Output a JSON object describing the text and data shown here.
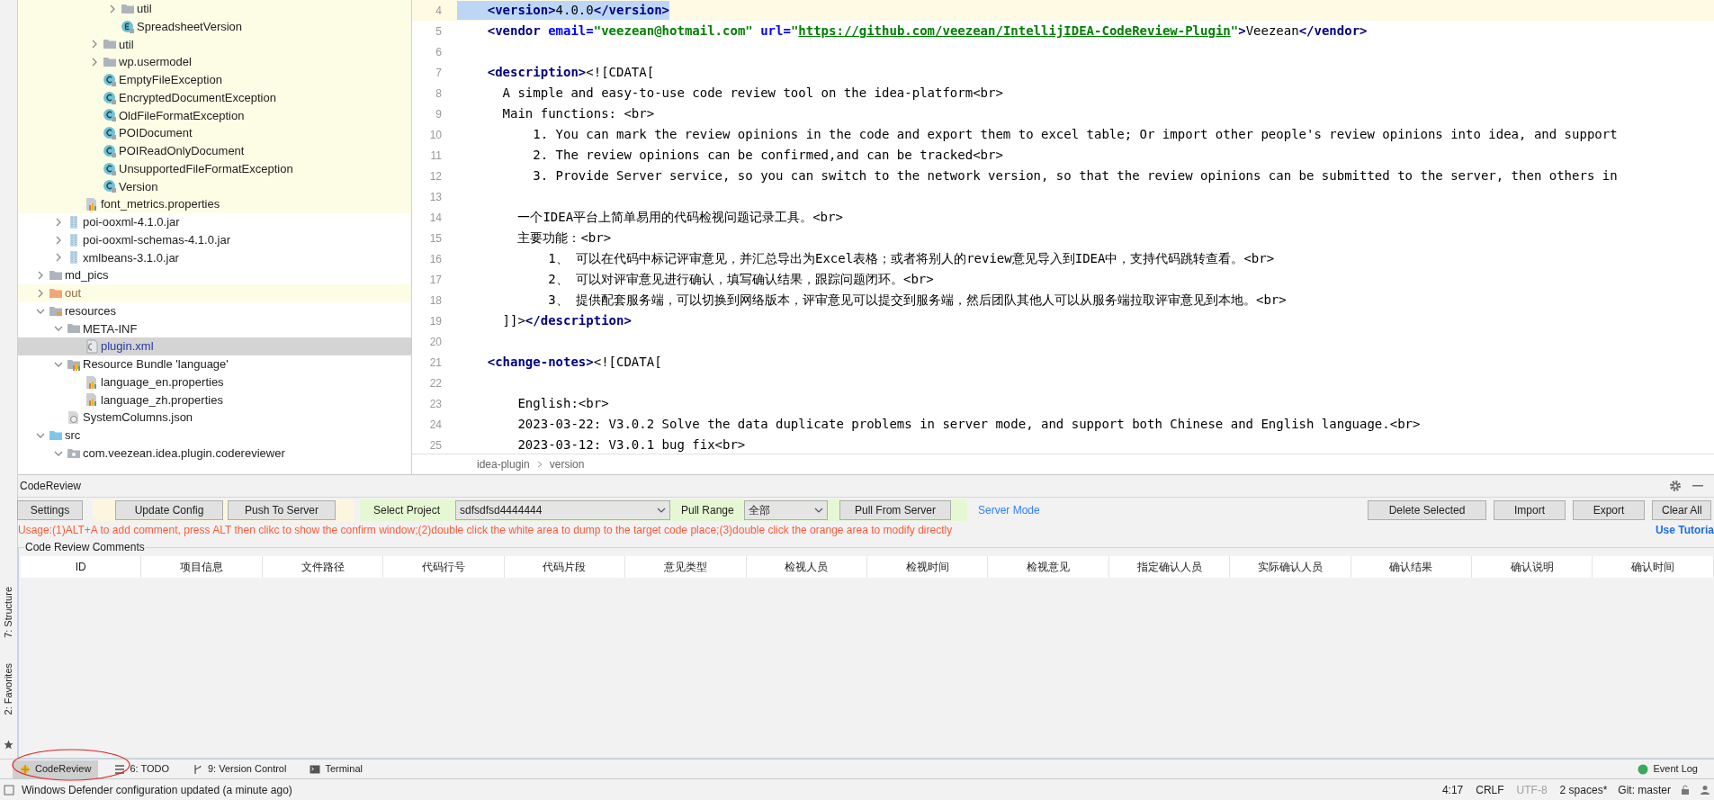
{
  "tool_stripe": [
    {
      "label": "7: Structure"
    },
    {
      "label": "2: Favorites"
    }
  ],
  "project_tree": [
    {
      "children": [
        {
          "children": [
            {
              "children": [
                {
                  "children": [
                    {
                      "label": "util",
                      "kind": "folder",
                      "expanded": false,
                      "highlighted": true
                    },
                    {
                      "label": "SpreadsheetVersion",
                      "kind": "enum",
                      "highlighted": true
                    }
                  ]
                },
                {
                  "label": "util",
                  "kind": "folder",
                  "expanded": false,
                  "highlighted": true
                },
                {
                  "label": "wp.usermodel",
                  "kind": "folder",
                  "expanded": false,
                  "highlighted": true
                },
                {
                  "label": "EmptyFileException",
                  "kind": "class",
                  "highlighted": true
                },
                {
                  "label": "EncryptedDocumentException",
                  "kind": "class",
                  "highlighted": true
                },
                {
                  "label": "OldFileFormatException",
                  "kind": "class",
                  "highlighted": true
                },
                {
                  "label": "POIDocument",
                  "kind": "class",
                  "highlighted": true
                },
                {
                  "label": "POIReadOnlyDocument",
                  "kind": "class",
                  "highlighted": true
                },
                {
                  "label": "UnsupportedFileFormatException",
                  "kind": "class",
                  "highlighted": true
                },
                {
                  "label": "Version",
                  "kind": "class",
                  "highlighted": true
                }
              ]
            },
            {
              "label": "font_metrics.properties",
              "kind": "properties",
              "highlighted": true
            }
          ]
        },
        {
          "label": "poi-ooxml-4.1.0.jar",
          "kind": "jar",
          "expanded": false,
          "highlighted": false
        },
        {
          "label": "poi-ooxml-schemas-4.1.0.jar",
          "kind": "jar",
          "expanded": false,
          "highlighted": false
        },
        {
          "label": "xmlbeans-3.1.0.jar",
          "kind": "jar",
          "expanded": false,
          "highlighted": false
        }
      ]
    },
    {
      "label": "md_pics",
      "kind": "folder",
      "expanded": false,
      "highlighted": false
    },
    {
      "label": "out",
      "kind": "excluded-folder",
      "expanded": false,
      "highlighted": true
    },
    {
      "label": "resources",
      "kind": "resource-folder",
      "expanded": true,
      "highlighted": false,
      "children": [
        {
          "label": "META-INF",
          "kind": "folder",
          "expanded": true,
          "highlighted": false,
          "children": [
            {
              "label": "plugin.xml",
              "kind": "xml",
              "selected": true
            }
          ]
        },
        {
          "label": "Resource Bundle 'language'",
          "kind": "bundle",
          "expanded": true,
          "highlighted": false,
          "children": [
            {
              "label": "language_en.properties",
              "kind": "properties",
              "highlighted": false
            },
            {
              "label": "language_zh.properties",
              "kind": "properties",
              "highlighted": false
            }
          ]
        },
        {
          "label": "SystemColumns.json",
          "kind": "json",
          "highlighted": false
        }
      ]
    },
    {
      "label": "src",
      "kind": "source-folder",
      "expanded": true,
      "highlighted": false,
      "children": [
        {
          "label": "com.veezean.idea.plugin.codereviewer",
          "kind": "package",
          "expanded": true,
          "highlighted": false
        }
      ]
    }
  ],
  "editor": {
    "lines": [
      {
        "number": "4",
        "selected": true,
        "segments": [
          {
            "kind": "tag",
            "text": "    <version>"
          },
          {
            "kind": "plain",
            "text": "4.0.0"
          },
          {
            "kind": "tag",
            "text": "</version>"
          }
        ]
      },
      {
        "number": "5",
        "selected": false,
        "segments": [
          {
            "kind": "tag",
            "text": "    <vendor "
          },
          {
            "kind": "attr",
            "text": "email="
          },
          {
            "kind": "string",
            "text": "\"veezean@hotmail.com\" "
          },
          {
            "kind": "attr",
            "text": "url="
          },
          {
            "kind": "string",
            "text": "\""
          },
          {
            "kind": "link",
            "text": "https://github.com/veezean/IntellijIDEA-CodeReview-Plugin"
          },
          {
            "kind": "string",
            "text": "\""
          },
          {
            "kind": "tag",
            "text": ">"
          },
          {
            "kind": "plain",
            "text": "Veezean"
          },
          {
            "kind": "tag",
            "text": "</vendor>"
          }
        ]
      },
      {
        "number": "6",
        "selected": false
      },
      {
        "number": "7",
        "selected": false,
        "segments": [
          {
            "kind": "tag",
            "text": "    <description>"
          },
          {
            "kind": "plain",
            "text": "<![CDATA["
          }
        ]
      },
      {
        "number": "8",
        "selected": false,
        "segments": [
          {
            "kind": "plain",
            "text": "      A simple and easy-to-use code review tool on the idea-platform<br>"
          }
        ]
      },
      {
        "number": "9",
        "selected": false,
        "segments": [
          {
            "kind": "plain",
            "text": "      Main functions: <br>"
          }
        ]
      },
      {
        "number": "10",
        "selected": false,
        "segments": [
          {
            "kind": "plain",
            "text": "          1. You can mark the review opinions in the code and export them to excel table; Or import other people's review opinions into idea, and support"
          }
        ]
      },
      {
        "number": "11",
        "selected": false,
        "segments": [
          {
            "kind": "plain",
            "text": "          2. The review opinions can be confirmed,and can be tracked<br>"
          }
        ]
      },
      {
        "number": "12",
        "selected": false,
        "segments": [
          {
            "kind": "plain",
            "text": "          3. Provide Server service, so you can switch to the network version, so that the review opinions can be submitted to the server, then others in"
          }
        ]
      },
      {
        "number": "13",
        "selected": false
      },
      {
        "number": "14",
        "selected": false,
        "segments": [
          {
            "kind": "plain",
            "text": "        一个IDEA平台上简单易用的代码检视问题记录工具。<br>"
          }
        ]
      },
      {
        "number": "15",
        "selected": false,
        "segments": [
          {
            "kind": "plain",
            "text": "        主要功能：<br>"
          }
        ]
      },
      {
        "number": "16",
        "selected": false,
        "segments": [
          {
            "kind": "plain",
            "text": "            1、 可以在代码中标记评审意见，并汇总导出为Excel表格；或者将别人的review意见导入到IDEA中，支持代码跳转查看。<br>"
          }
        ]
      },
      {
        "number": "17",
        "selected": false,
        "segments": [
          {
            "kind": "plain",
            "text": "            2、 可以对评审意见进行确认，填写确认结果，跟踪问题闭环。<br>"
          }
        ]
      },
      {
        "number": "18",
        "selected": false,
        "segments": [
          {
            "kind": "plain",
            "text": "            3、 提供配套服务端，可以切换到网络版本，评审意见可以提交到服务端，然后团队其他人可以从服务端拉取评审意见到本地。<br>"
          }
        ]
      },
      {
        "number": "19",
        "selected": false,
        "segments": [
          {
            "kind": "plain",
            "text": "      ]]>"
          },
          {
            "kind": "tag",
            "text": "</description>"
          }
        ]
      },
      {
        "number": "20",
        "selected": false
      },
      {
        "number": "21",
        "selected": false,
        "segments": [
          {
            "kind": "tag",
            "text": "    <change-notes>"
          },
          {
            "kind": "plain",
            "text": "<![CDATA["
          }
        ]
      },
      {
        "number": "22",
        "selected": false
      },
      {
        "number": "23",
        "selected": false,
        "segments": [
          {
            "kind": "plain",
            "text": "        English:<br>"
          }
        ]
      },
      {
        "number": "24",
        "selected": false,
        "segments": [
          {
            "kind": "plain",
            "text": "        2023-03-22: V3.0.2 Solve the data duplicate problems in server mode, and support both Chinese and English language.<br>"
          }
        ]
      },
      {
        "number": "25",
        "selected": false,
        "segments": [
          {
            "kind": "plain",
            "text": "        2023-03-12: V3.0.1 bug fix<br>"
          }
        ]
      }
    ],
    "breadcrumbs": [
      "idea-plugin",
      "version"
    ]
  },
  "code_review_panel": {
    "title": "CodeReview",
    "settings_button": "Settings",
    "config_buttons": [
      "Update Config",
      "Push To Server"
    ],
    "select_project": {
      "label": "Select Project",
      "value": "sdfsdfsd4444444"
    },
    "pull_range": {
      "label": "Pull Range",
      "value": "全部"
    },
    "pull_button": "Pull From Server",
    "mode_link": "Server Mode",
    "right_buttons": [
      "Delete Selected",
      "Import",
      "Export",
      "Clear All"
    ],
    "usage": "Usage:(1)ALT+A to add comment, press ALT then clikc to show the confirm window;(2)double click the white area to dump to the target code place;(3)double click the orange area to modify directly",
    "tutorial_link": "Use Tutoria",
    "table_title": "Code Review Comments",
    "table": {
      "columns": [
        "ID",
        "项目信息",
        "文件路径",
        "代码行号",
        "代码片段",
        "意见类型",
        "检视人员",
        "检视时间",
        "检视意见",
        "指定确认人员",
        "实际确认人员",
        "确认结果",
        "确认说明",
        "确认时间"
      ]
    }
  },
  "tool_tabs": [
    {
      "label": "CodeReview",
      "selected": true
    },
    {
      "label": "6: TODO",
      "selected": false
    },
    {
      "label": "9: Version Control",
      "selected": false
    },
    {
      "label": "Terminal",
      "selected": false
    }
  ],
  "event_log": "Event Log",
  "status_bar": {
    "message": "Windows Defender configuration updated (a minute ago)",
    "position": "4:17",
    "line_separator": "CRLF",
    "encoding": "UTF-8",
    "indent": "2 spaces*",
    "branch": "Git: master"
  }
}
